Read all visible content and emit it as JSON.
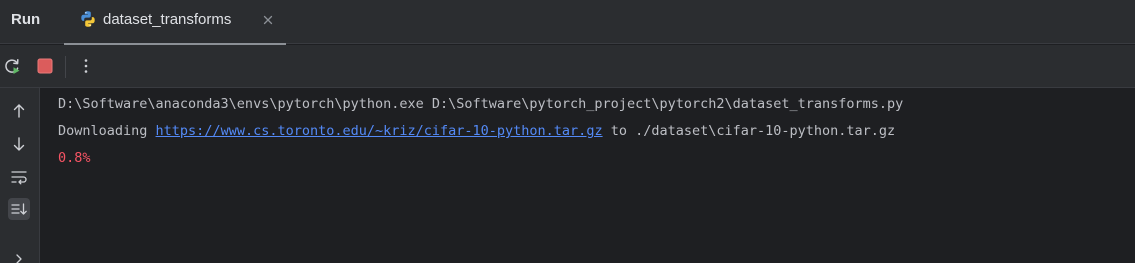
{
  "panel": {
    "title": "Run"
  },
  "tab": {
    "label": "dataset_transforms",
    "icon": "python-file-icon"
  },
  "toolbar": {
    "rerun_icon": "rerun-icon",
    "stop_icon": "stop-icon",
    "more_icon": "more-vertical-icon"
  },
  "gutter": {
    "icons": [
      "arrow-up-icon",
      "arrow-down-icon",
      "soft-wrap-icon",
      "scroll-to-end-icon"
    ]
  },
  "console": {
    "command_line": "D:\\Software\\anaconda3\\envs\\pytorch\\python.exe D:\\Software\\pytorch_project\\pytorch2\\dataset_transforms.py",
    "download_prefix": "Downloading ",
    "download_url": "https://www.cs.toronto.edu/~kriz/cifar-10-python.tar.gz",
    "download_suffix": " to ./dataset\\cifar-10-python.tar.gz",
    "progress": "0.8%"
  },
  "colors": {
    "background": "#1e1f22",
    "panel": "#2b2d30",
    "text": "#bcbec4",
    "link": "#548af7",
    "error": "#f75464",
    "rerun_green": "#5fb865",
    "stop_red": "#db5c5c"
  }
}
